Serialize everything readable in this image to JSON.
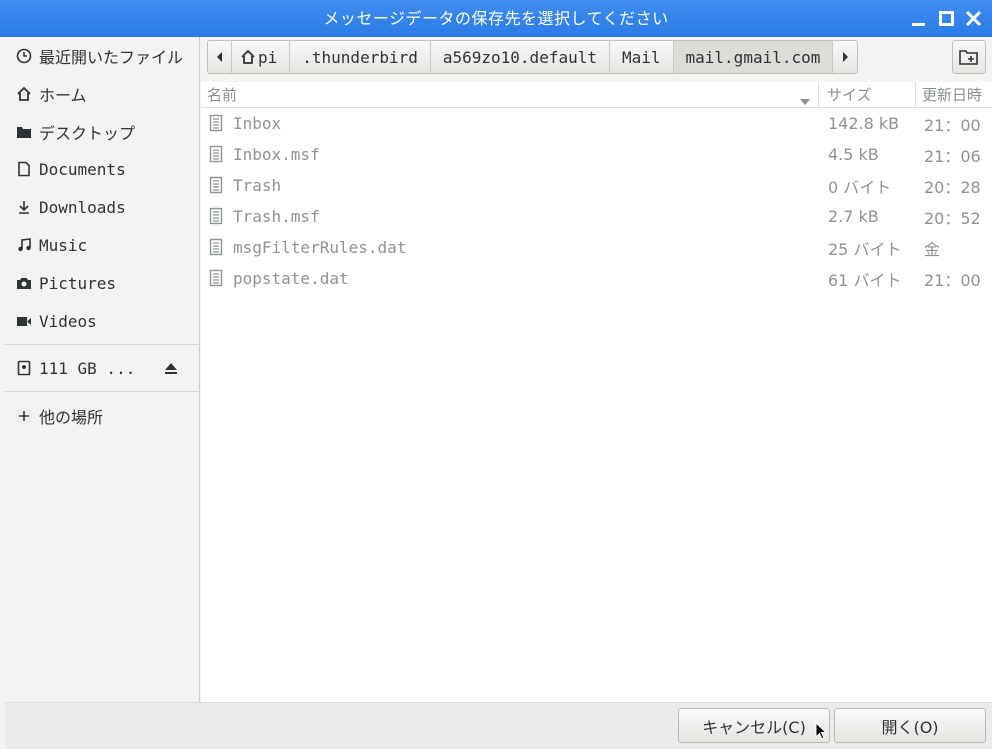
{
  "window": {
    "title": "メッセージデータの保存先を選択してください"
  },
  "sidebar": {
    "items": [
      {
        "label": "最近開いたファイル",
        "icon": "clock-icon"
      },
      {
        "label": "ホーム",
        "icon": "home-icon"
      },
      {
        "label": "デスクトップ",
        "icon": "folder-icon"
      },
      {
        "label": "Documents",
        "icon": "document-icon"
      },
      {
        "label": "Downloads",
        "icon": "download-icon"
      },
      {
        "label": "Music",
        "icon": "music-icon"
      },
      {
        "label": "Pictures",
        "icon": "camera-icon"
      },
      {
        "label": "Videos",
        "icon": "video-icon"
      }
    ],
    "drive": {
      "label": "111 GB ...",
      "icon": "drive-icon"
    },
    "other": {
      "label": "他の場所",
      "icon": "plus-icon"
    }
  },
  "pathbar": {
    "crumbs": [
      "pi",
      ".thunderbird",
      "a569zo10.default",
      "Mail",
      "mail.gmail.com"
    ]
  },
  "columns": {
    "name": "名前",
    "size": "サイズ",
    "modified": "更新日時"
  },
  "files": [
    {
      "name": "Inbox",
      "size": "142.8 kB",
      "modified": "21：00"
    },
    {
      "name": "Inbox.msf",
      "size": "4.5 kB",
      "modified": "21：06"
    },
    {
      "name": "Trash",
      "size": "0 バイト",
      "modified": "20：28"
    },
    {
      "name": "Trash.msf",
      "size": "2.7 kB",
      "modified": "20：52"
    },
    {
      "name": "msgFilterRules.dat",
      "size": "25 バイト",
      "modified": "金"
    },
    {
      "name": "popstate.dat",
      "size": "61 バイト",
      "modified": "21：00"
    }
  ],
  "buttons": {
    "cancel": "キャンセル(C)",
    "open": "開く(O)"
  },
  "colors": {
    "titlebar": "#2a7be6",
    "file_text": "#8e9393"
  }
}
